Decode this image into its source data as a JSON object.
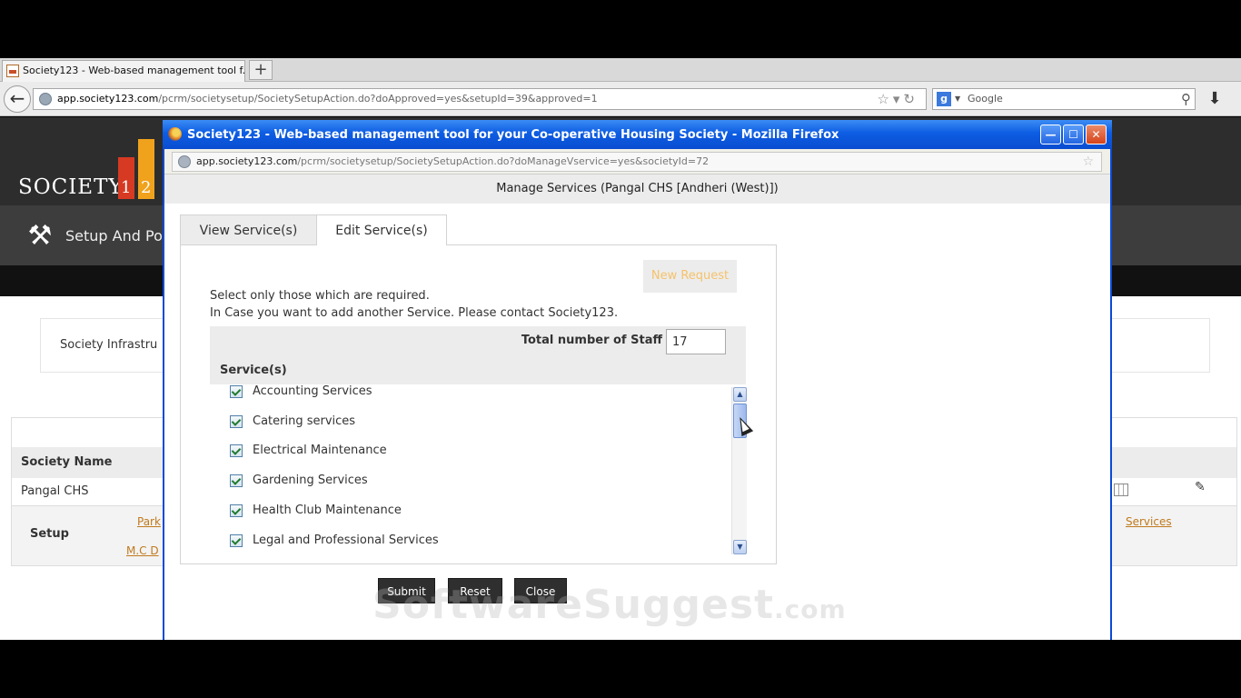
{
  "outer_browser": {
    "tab_title": "Society123 - Web-based management tool f...",
    "new_tab": "+",
    "url_host": "app.society123.com",
    "url_path": "/pcrm/societysetup/SocietySetupAction.do?doApproved=yes&setupId=39&approved=1",
    "search_placeholder": "Google"
  },
  "background_page": {
    "logo_text": "SOCIETY",
    "logo_digits": [
      "1",
      "2"
    ],
    "menu_label": "Setup And Po",
    "infra_label": "Society Infrastru",
    "table": {
      "col_society_name": "Society Name",
      "society_name_value": "Pangal CHS",
      "setup_label": "Setup",
      "link_park": "Park",
      "link_mc": "M.C D",
      "link_services": "Services"
    }
  },
  "popup": {
    "title": "Society123 - Web-based management tool for your Co-operative Housing Society - Mozilla Firefox",
    "url_host": "app.society123.com",
    "url_path": "/pcrm/societysetup/SocietySetupAction.do?doManageVservice=yes&societyId=72",
    "header": "Manage Services (Pangal CHS [Andheri (West)])",
    "tabs": [
      {
        "label": "View Service(s)"
      },
      {
        "label": "Edit Service(s)"
      }
    ],
    "new_request_label": "New Request",
    "instruction_1": "Select only those which are required.",
    "instruction_2": "In Case you want to add another Service. Please contact Society123.",
    "staff_label": "Total number of Staff",
    "staff_value": "17",
    "services_header": "Service(s)",
    "services": [
      {
        "label": "Accounting Services",
        "checked": true
      },
      {
        "label": "Catering services",
        "checked": true
      },
      {
        "label": "Electrical Maintenance",
        "checked": true
      },
      {
        "label": "Gardening Services",
        "checked": true
      },
      {
        "label": "Health Club Maintenance",
        "checked": true
      },
      {
        "label": "Legal and Professional Services",
        "checked": true
      }
    ],
    "buttons": {
      "submit": "Submit",
      "reset": "Reset",
      "close": "Close"
    }
  },
  "watermark": {
    "main": "SoftwareSuggest",
    "suffix": ".com"
  }
}
